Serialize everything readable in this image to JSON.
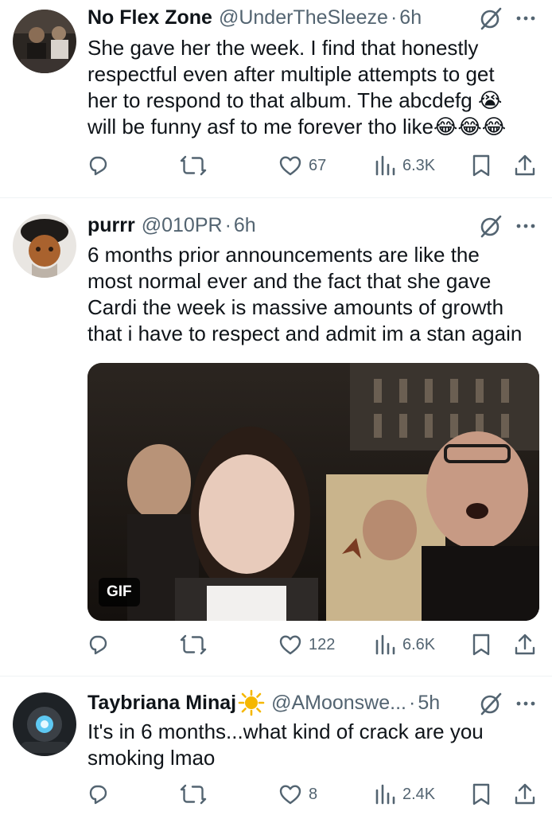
{
  "tweets": [
    {
      "name": "No Flex Zone",
      "handle": "@UnderTheSleeze",
      "dot": "·",
      "time": "6h",
      "body_lines": [
        "She gave her the week. I find that honestly",
        "respectful even after multiple attempts to get",
        "her to respond to that album. The abcdefg 😭",
        "will be funny asf to me forever tho like😂😂😂"
      ],
      "stats": {
        "replies": "",
        "retweets": "",
        "likes": "67",
        "views": "6.3K"
      }
    },
    {
      "name": "purrr",
      "handle": "@010PR",
      "dot": "·",
      "time": "6h",
      "body_lines": [
        "6 months prior announcements are like the",
        "most normal ever and the fact that she gave",
        "Cardi the week is massive amounts of growth",
        "that i have to respect and admit im a stan again"
      ],
      "media_badge": "GIF",
      "stats": {
        "replies": "",
        "retweets": "",
        "likes": "122",
        "views": "6.6K"
      }
    },
    {
      "name": "Taybriana Minaj",
      "handle": "@AMoonswe...",
      "dot": "·",
      "time": "5h",
      "body_lines": [
        "It's in 6 months...what kind of crack are you",
        "smoking lmao"
      ],
      "stats": {
        "replies": "",
        "retweets": "",
        "likes": "8",
        "views": "2.4K"
      }
    }
  ],
  "colors": {
    "text": "#0f1419",
    "secondary": "#536471",
    "divider": "#eff3f4",
    "sun": "#f5b700"
  },
  "icons": [
    "reply-icon",
    "retweet-icon",
    "like-icon",
    "views-icon",
    "bookmark-icon",
    "share-icon",
    "grok-icon",
    "more-icon",
    "sun-emoji-icon"
  ]
}
